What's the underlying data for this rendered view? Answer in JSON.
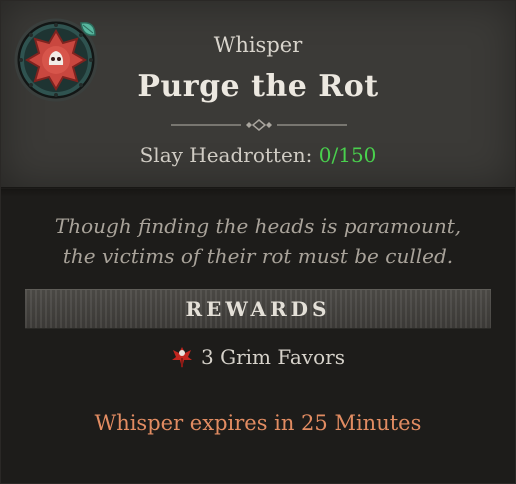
{
  "quest": {
    "category": "Whisper",
    "title": "Purge the Rot",
    "objective_label": "Slay Headrotten:",
    "objective_progress": "0/150",
    "description_line1": "Though finding the heads is paramount,",
    "description_line2": "the victims of their rot must be culled."
  },
  "rewards": {
    "header": "REWARDS",
    "item": "3 Grim Favors",
    "item_icon": "grim-favor-icon"
  },
  "footer": {
    "expiry": "Whisper expires in 25 Minutes"
  },
  "colors": {
    "progress": "#49d04d",
    "expiry": "#e28c62",
    "emblem_red": "#c9473f",
    "emblem_teal": "#2e4a46"
  }
}
